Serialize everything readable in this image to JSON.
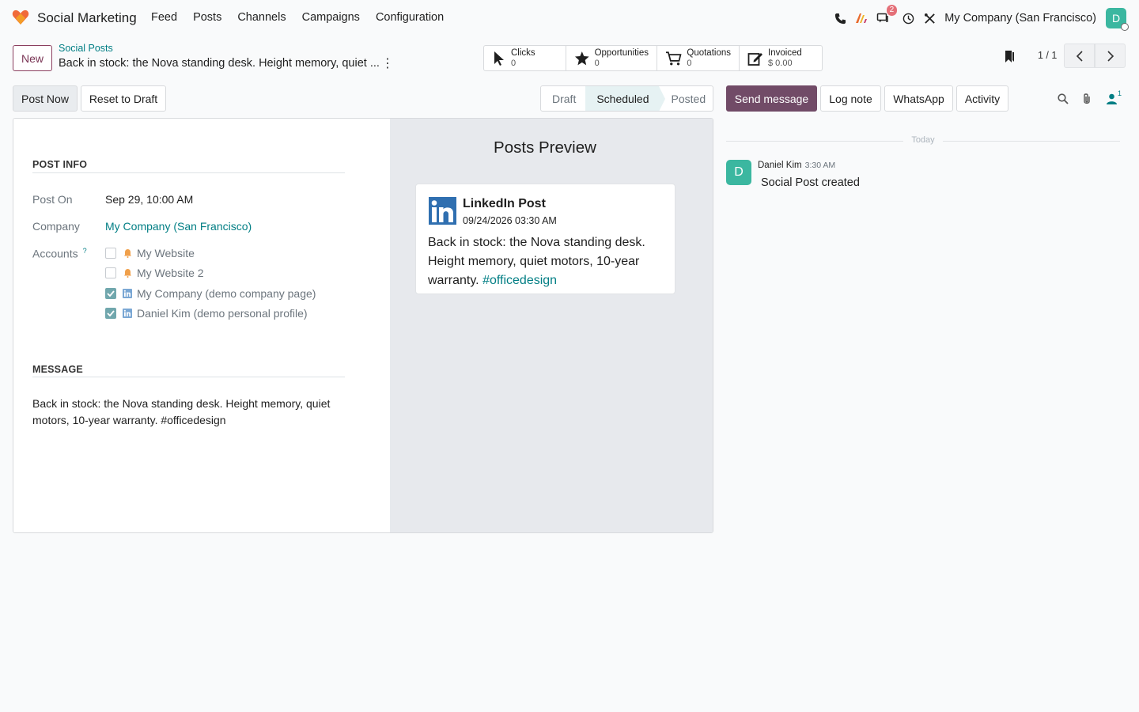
{
  "navbar": {
    "brand": "Social Marketing",
    "menu": [
      "Feed",
      "Posts",
      "Channels",
      "Campaigns",
      "Configuration"
    ],
    "messages_badge": "2",
    "company": "My Company (San Francisco)",
    "avatar_initial": "D"
  },
  "control_panel": {
    "new_label": "New",
    "breadcrumb": "Social Posts",
    "record_title": "Back in stock: the Nova standing desk. Height memory, quiet ...",
    "stats": [
      {
        "label": "Clicks",
        "value": "0",
        "icon": "cursor-icon"
      },
      {
        "label": "Opportunities",
        "value": "0",
        "icon": "star-icon"
      },
      {
        "label": "Quotations",
        "value": "0",
        "icon": "cart-icon"
      },
      {
        "label": "Invoiced",
        "value": "$ 0.00",
        "icon": "edit-icon"
      }
    ],
    "pager": "1 / 1"
  },
  "actions": {
    "post_now": "Post Now",
    "reset_to_draft": "Reset to Draft"
  },
  "statusbar": {
    "stages": [
      "Draft",
      "Scheduled",
      "Posted"
    ],
    "active": "Scheduled"
  },
  "form": {
    "post_info_title": "POST INFO",
    "post_on_label": "Post On",
    "post_on_value": "Sep 29, 10:00 AM",
    "company_label": "Company",
    "company_value": "My Company (San Francisco)",
    "accounts_label": "Accounts",
    "accounts_help": "?",
    "accounts": [
      {
        "name": "My Website",
        "checked": false,
        "icon": "bell-icon"
      },
      {
        "name": "My Website 2",
        "checked": false,
        "icon": "bell-icon"
      },
      {
        "name": "My Company (demo company page)",
        "checked": true,
        "icon": "linkedin-icon"
      },
      {
        "name": "Daniel Kim (demo personal profile)",
        "checked": true,
        "icon": "linkedin-icon"
      }
    ],
    "message_title": "MESSAGE",
    "message_text": "Back in stock: the Nova standing desk. Height memory, quiet motors, 10-year warranty. #officedesign"
  },
  "preview": {
    "title": "Posts Preview",
    "card_title": "LinkedIn Post",
    "card_date": "09/24/2026 03:30 AM",
    "card_body": "Back in stock: the Nova standing desk. Height memory, quiet motors, 10-year warranty.",
    "card_hashtag": "#officedesign"
  },
  "chatter": {
    "send_message": "Send message",
    "log_note": "Log note",
    "whatsapp": "WhatsApp",
    "activity": "Activity",
    "follower_count": "1",
    "today": "Today",
    "messages": [
      {
        "author": "Daniel Kim",
        "time": "3:30 AM",
        "body": "Social Post created",
        "initial": "D"
      }
    ]
  },
  "colors": {
    "brand": "#714b67",
    "link": "#017e84",
    "avatar": "#3bb7a0",
    "badge": "#e46f78",
    "linkedin": "#2f6fb0"
  }
}
